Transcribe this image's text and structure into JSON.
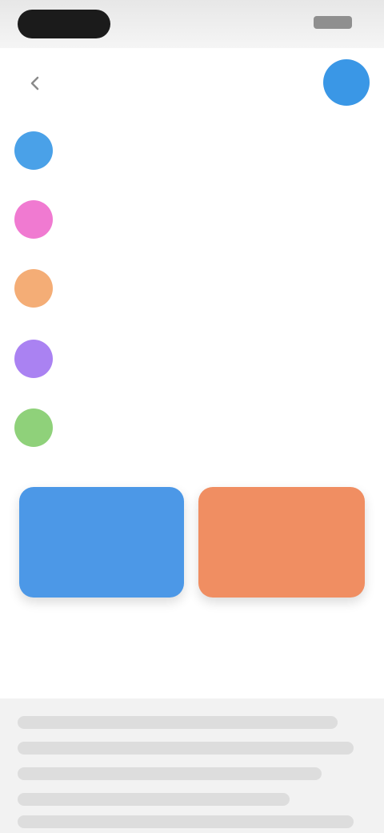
{
  "status_bar": {
    "time": "",
    "indicators": ""
  },
  "header": {
    "title": "",
    "back_icon": "chevron-left-icon",
    "avatar_color": "#3a97e6"
  },
  "items": [
    {
      "text": "",
      "color": "#4aa1e8"
    },
    {
      "text": "",
      "color": "#f07ad1"
    },
    {
      "text": "",
      "color": "#f4ad76"
    },
    {
      "text": "",
      "color": "#aa82f2"
    },
    {
      "text": "",
      "color": "#8fd17a"
    }
  ],
  "actions": [
    {
      "line1": "",
      "line2": "",
      "color": "#4c98e7"
    },
    {
      "line1": "",
      "line2": "",
      "color": "#f08e62"
    }
  ],
  "link": {
    "text": ""
  },
  "bottom_sheet": {
    "text": ""
  }
}
